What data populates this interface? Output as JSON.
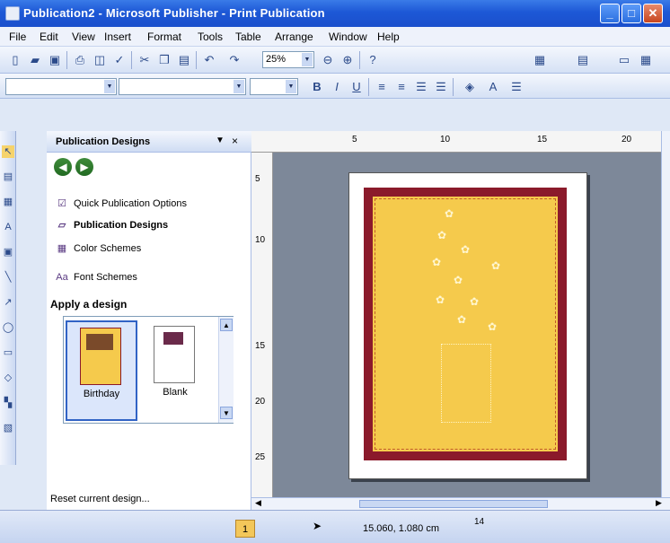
{
  "window": {
    "title": "Publication2 - Microsoft Publisher - Print Publication"
  },
  "menu": [
    "File",
    "Edit",
    "View",
    "Insert",
    "Format",
    "Tools",
    "Table",
    "Arrange",
    "Window",
    "Help"
  ],
  "toolbar": {
    "zoom": "25%"
  },
  "taskpane": {
    "title": "Publication Designs",
    "links": [
      "Quick Publication Options",
      "Publication Designs",
      "Color Schemes",
      "Font Schemes"
    ],
    "apply_heading": "Apply a design",
    "designs": [
      {
        "label": "Birthday",
        "selected": true
      },
      {
        "label": "Blank",
        "selected": false
      }
    ],
    "reset": "Reset current design..."
  },
  "ruler": {
    "top": [
      "5",
      "10",
      "15",
      "20"
    ],
    "left": [
      "5",
      "10",
      "15",
      "20",
      "25"
    ]
  },
  "status": {
    "page": "1",
    "position": "15.060, 1.080 cm",
    "size": "14"
  },
  "colors": {
    "title_bar": "#1d58d6",
    "card_border": "#8b1a2b",
    "card_fill": "#f5ca4c",
    "canvas": "#7d8899"
  },
  "icons": [
    "publisher-app-icon",
    "minimize-icon",
    "maximize-icon",
    "close-icon",
    "back-icon",
    "forward-icon",
    "pointer-icon"
  ]
}
